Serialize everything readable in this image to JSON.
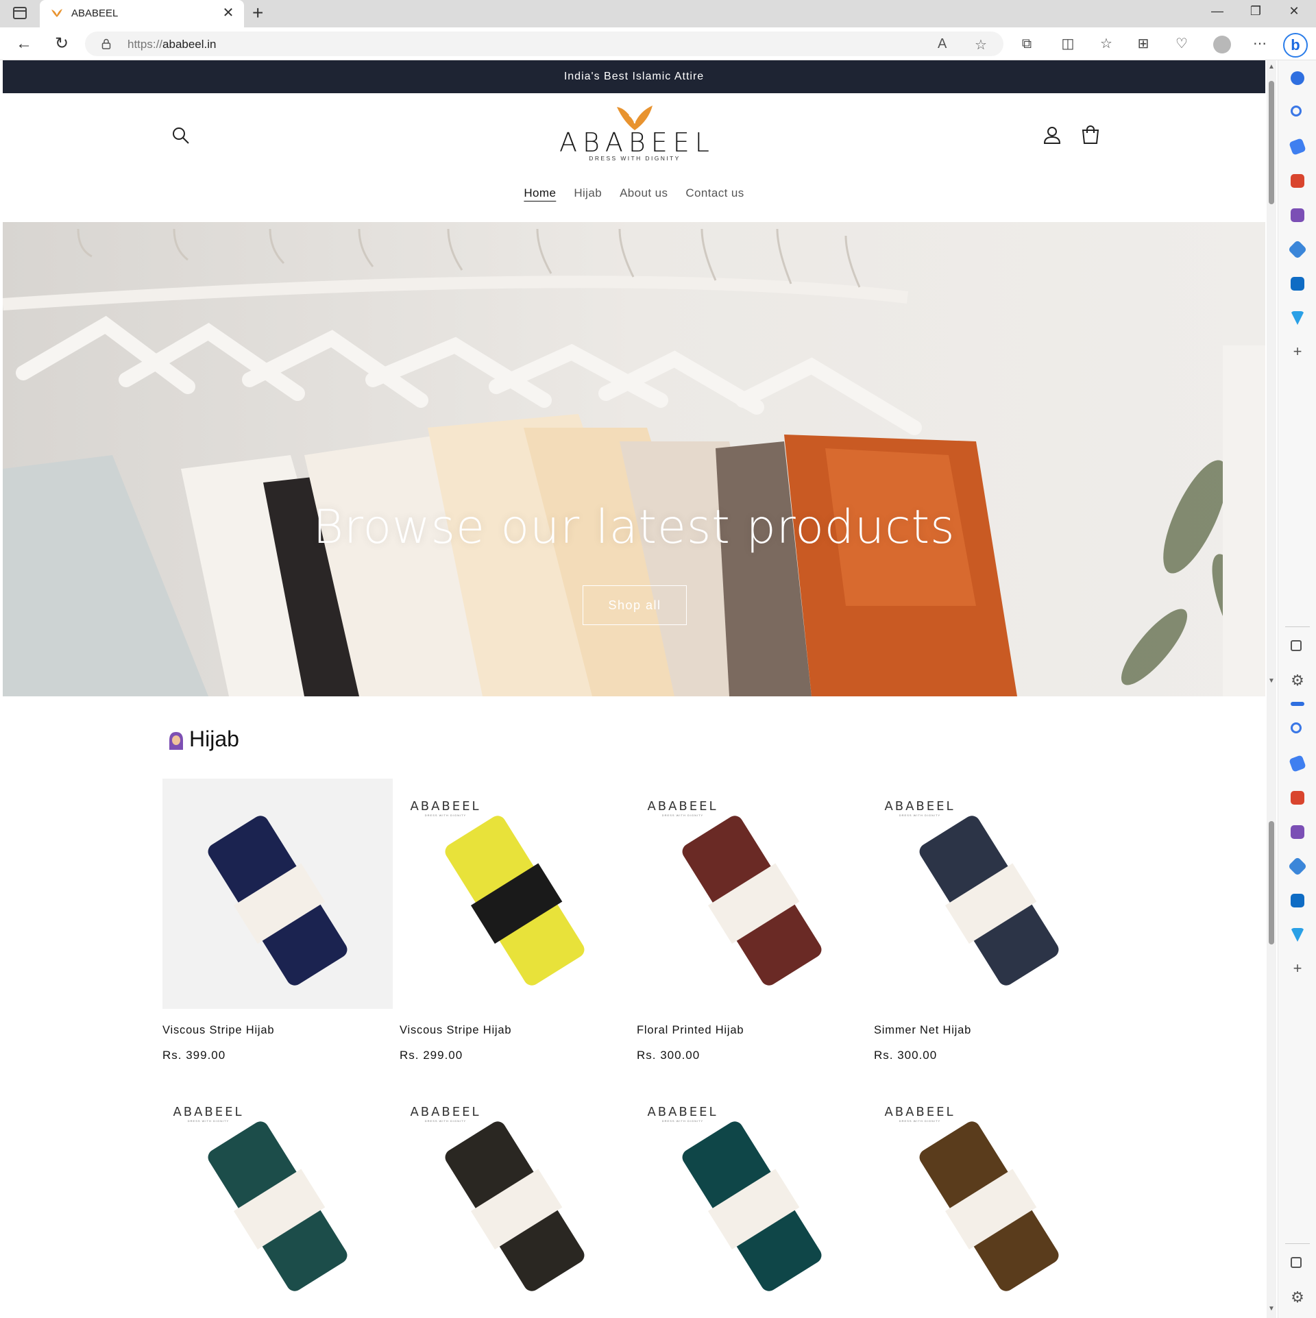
{
  "browser": {
    "tab_title": "ABABEEL",
    "url_protocol": "https://",
    "url_host": "ababeel.in"
  },
  "site": {
    "announcement": "India's Best Islamic Attire",
    "logo_word": "ABABEEL",
    "logo_tagline": "DRESS WITH DIGNITY",
    "brand_color": "#e8932f",
    "nav": [
      {
        "label": "Home",
        "active": true
      },
      {
        "label": "Hijab",
        "active": false
      },
      {
        "label": "About us",
        "active": false
      },
      {
        "label": "Contact us",
        "active": false
      }
    ]
  },
  "hero": {
    "title": "Browse our latest products",
    "button": "Shop all"
  },
  "collection": {
    "heading": "Hijab",
    "products": [
      {
        "title": "Viscous Stripe Hijab",
        "price": "Rs. 399.00",
        "color": "#1b2350"
      },
      {
        "title": "Viscous Stripe Hijab",
        "price": "Rs. 299.00",
        "color": "#e8e23a"
      },
      {
        "title": "Floral Printed Hijab",
        "price": "Rs. 300.00",
        "color": "#6a2a25"
      },
      {
        "title": "Simmer Net Hijab",
        "price": "Rs. 300.00",
        "color": "#2c3447"
      },
      {
        "title": "",
        "price": "",
        "color": "#1c4d4a"
      },
      {
        "title": "",
        "price": "",
        "color": "#2a2722"
      },
      {
        "title": "",
        "price": "",
        "color": "#0f4648"
      },
      {
        "title": "",
        "price": "",
        "color": "#5a3c1c"
      }
    ]
  }
}
